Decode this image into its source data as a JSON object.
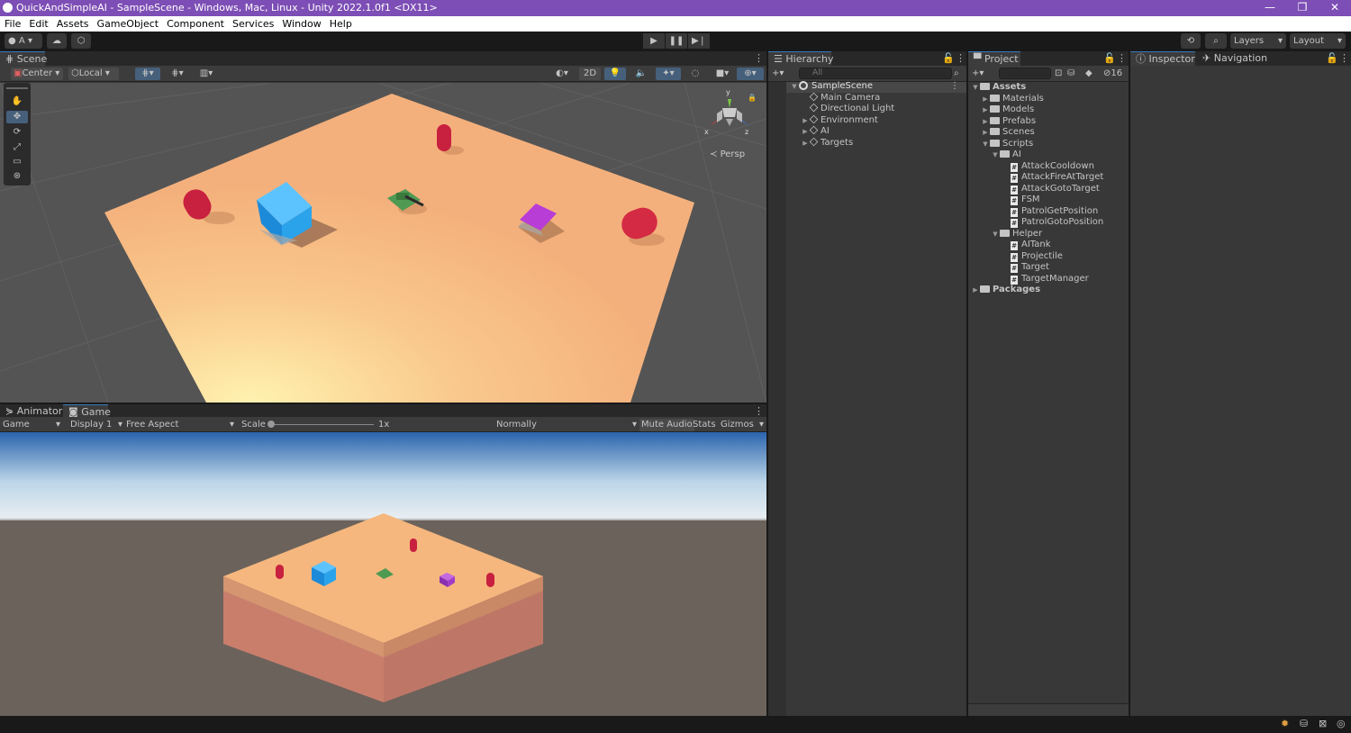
{
  "window": {
    "title": "QuickAndSimpleAI - SampleScene - Windows, Mac, Linux - Unity 2022.1.0f1 <DX11>",
    "minimize": "—",
    "maximize": "❐",
    "close": "✕"
  },
  "menu": [
    "File",
    "Edit",
    "Assets",
    "GameObject",
    "Component",
    "Services",
    "Window",
    "Help"
  ],
  "toolbar": {
    "account": "A",
    "play": "▶",
    "pause": "❚❚",
    "step": "▶❘",
    "layers": "Layers",
    "layout": "Layout"
  },
  "scene": {
    "tab": "Scene",
    "pivot": "Center",
    "space": "Local",
    "mode_2d": "2D",
    "persp": "Persp",
    "gizmo_y": "y",
    "gizmo_x": "x",
    "gizmo_z": "z"
  },
  "game": {
    "tab_animator": "Animator",
    "tab_game": "Game",
    "view": "Game",
    "display": "Display 1",
    "aspect": "Free Aspect",
    "scale_label": "Scale",
    "scale_value": "1x",
    "play_mode": "Normally",
    "mute": "Mute Audio",
    "stats": "Stats",
    "gizmos": "Gizmos"
  },
  "hierarchy": {
    "tab": "Hierarchy",
    "search_placeholder": "All",
    "scene": "SampleScene",
    "items": [
      {
        "label": "Main Camera",
        "expandable": false
      },
      {
        "label": "Directional Light",
        "expandable": false
      },
      {
        "label": "Environment",
        "expandable": true
      },
      {
        "label": "AI",
        "expandable": true
      },
      {
        "label": "Targets",
        "expandable": true
      }
    ]
  },
  "project": {
    "tab": "Project",
    "hidden_count": "16",
    "tree": {
      "assets": "Assets",
      "materials": "Materials",
      "models": "Models",
      "prefabs": "Prefabs",
      "scenes": "Scenes",
      "scripts": "Scripts",
      "ai": "AI",
      "ai_scripts": [
        "AttackCooldown",
        "AttackFireAtTarget",
        "AttackGotoTarget",
        "FSM",
        "PatrolGetPosition",
        "PatrolGotoPosition"
      ],
      "helper": "Helper",
      "helper_scripts": [
        "AITank",
        "Projectile",
        "Target",
        "TargetManager"
      ],
      "packages": "Packages"
    }
  },
  "inspector": {
    "tab_inspector": "Inspector",
    "tab_navigation": "Navigation"
  },
  "colors": {
    "titlebar": "#7d4eb5",
    "ground": "#f5b77e",
    "accent": "#3a79bb"
  }
}
